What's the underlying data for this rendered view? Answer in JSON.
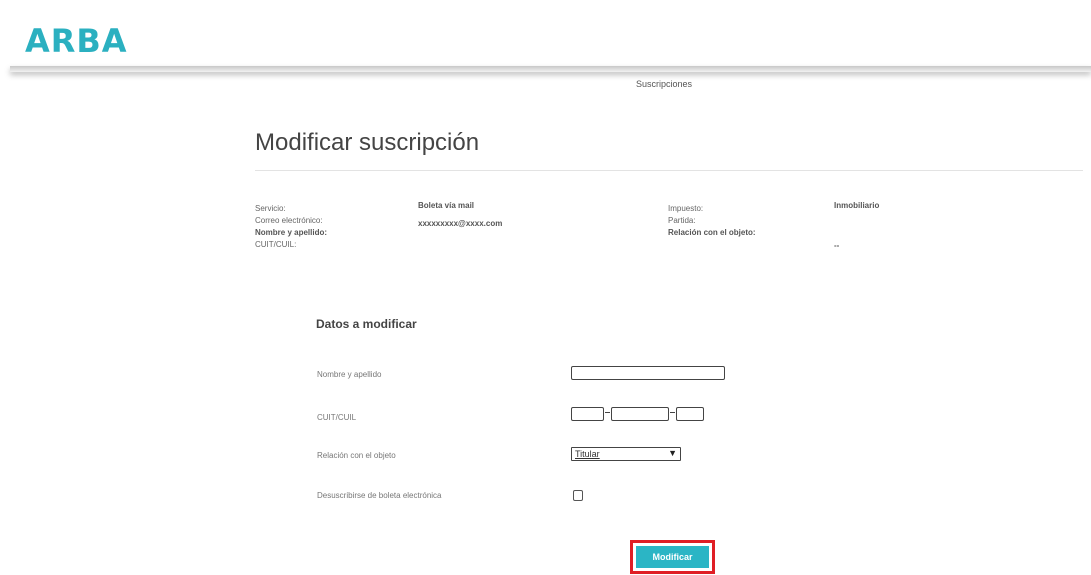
{
  "header": {
    "logo": "ARBA",
    "nav_link": "Suscripciones"
  },
  "page_title": "Modificar suscripción",
  "info": {
    "left_labels": [
      "Servicio:",
      "Correo electrónico:",
      "Nombre y apellido:",
      "CUIT/CUIL:"
    ],
    "left_values": [
      "Boleta vía mail",
      "xxxxxxxxx@xxxx.com"
    ],
    "right_labels": [
      "Impuesto:",
      "Partida:",
      "Relación con el objeto:"
    ],
    "right_values": [
      "Inmobiliario",
      "",
      "--"
    ]
  },
  "form": {
    "section_title": "Datos a modificar",
    "nombre_label": "Nombre y apellido",
    "nombre_value": "",
    "cuit_label": "CUIT/CUIL",
    "cuit_values": [
      "",
      "",
      ""
    ],
    "relacion_label": "Relación con el objeto",
    "relacion_selected": "Titular",
    "desuscribir_label": "Desuscribirse de boleta electrónica",
    "desuscribir_checked": false,
    "submit_label": "Modificar"
  },
  "colors": {
    "brand": "#2bb0c0",
    "button": "#2bb5c5",
    "highlight": "#e01e25"
  }
}
